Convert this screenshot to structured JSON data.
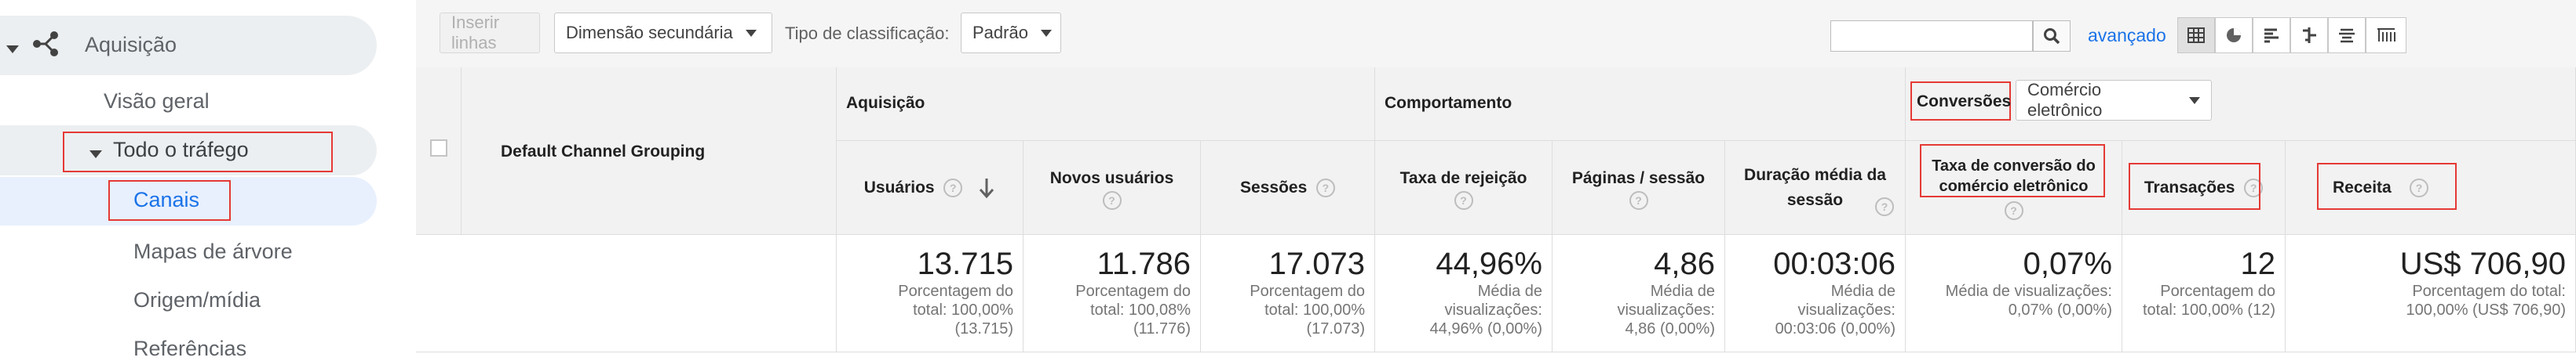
{
  "sidebar": {
    "section_label": "Aquisição",
    "items": [
      {
        "label": "Visão geral"
      },
      {
        "label": "Todo o tráfego"
      },
      {
        "label": "Canais"
      },
      {
        "label": "Mapas de árvore"
      },
      {
        "label": "Origem/mídia"
      },
      {
        "label": "Referências"
      }
    ]
  },
  "toolbar": {
    "insert_rows": "Inserir linhas",
    "secondary_dimension": "Dimensão secundária",
    "sort_type_label": "Tipo de classificação:",
    "sort_type_value": "Padrão",
    "search_value": "",
    "advanced": "avançado"
  },
  "table": {
    "dimension_header": "Default Channel Grouping",
    "groups": {
      "acquisition": "Aquisição",
      "behavior": "Comportamento",
      "conversions": "Conversões",
      "conversions_select": "Comércio eletrônico"
    },
    "metrics": [
      {
        "label": "Usuários"
      },
      {
        "label": "Novos usuários"
      },
      {
        "label": "Sessões"
      },
      {
        "label": "Taxa de rejeição"
      },
      {
        "label": "Páginas / sessão"
      },
      {
        "label": "Duração média da sessão"
      },
      {
        "label": "Taxa de conversão do comércio eletrônico"
      },
      {
        "label": "Transações"
      },
      {
        "label": "Receita"
      }
    ],
    "totals": [
      {
        "value": "13.715",
        "sub": "Porcentagem do total: 100,00% (13.715)"
      },
      {
        "value": "11.786",
        "sub": "Porcentagem do total: 100,08% (11.776)"
      },
      {
        "value": "17.073",
        "sub": "Porcentagem do total: 100,00% (17.073)"
      },
      {
        "value": "44,96%",
        "sub": "Média de visualizações: 44,96% (0,00%)"
      },
      {
        "value": "4,86",
        "sub": "Média de visualizações: 4,86 (0,00%)"
      },
      {
        "value": "00:03:06",
        "sub": "Média de visualizações: 00:03:06 (0,00%)"
      },
      {
        "value": "0,07%",
        "sub": "Média de visualizações: 0,07% (0,00%)"
      },
      {
        "value": "12",
        "sub": "Porcentagem do total: 100,00% (12)"
      },
      {
        "value": "US$ 706,90",
        "sub": "Porcentagem do total: 100,00% (US$ 706,90)"
      }
    ]
  },
  "colors": {
    "highlight": "#e53935",
    "link": "#1a73e8",
    "active_bg": "#e8f0fe"
  }
}
